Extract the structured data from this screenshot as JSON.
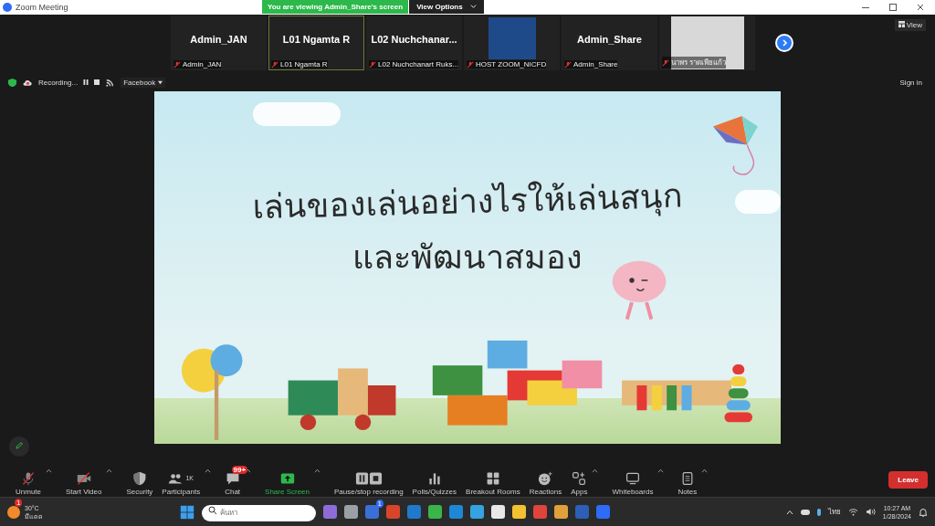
{
  "window": {
    "title": "Zoom Meeting"
  },
  "share_banner": {
    "text": "You are viewing Admin_Share's screen",
    "button": "View Options"
  },
  "participants": [
    {
      "kind": "name",
      "display": "Admin_JAN",
      "label": "Admin_JAN",
      "selected": false
    },
    {
      "kind": "name",
      "display": "L01 Ngamta R",
      "label": "L01 Ngamta R",
      "selected": true
    },
    {
      "kind": "name",
      "display": "L02  Nuchchanar...",
      "label": "L02 Nuchchanart Ruks...",
      "selected": false
    },
    {
      "kind": "logo",
      "label": "HOST ZOOM_NICFD",
      "selected": false
    },
    {
      "kind": "name",
      "display": "Admin_Share",
      "label": "Admin_Share",
      "selected": false
    },
    {
      "kind": "video",
      "label": "นาพร ราดเพียแก้ว",
      "selected": false
    }
  ],
  "view_button": "View",
  "recording": {
    "label": "Recording...",
    "stream": "Facebook"
  },
  "sign_in": "Sign in",
  "slide": {
    "title_line1": "เล่นของเล่นอย่างไรให้เล่นสนุก",
    "title_line2": "และพัฒนาสมอง"
  },
  "toolbar": [
    {
      "kind": "mic",
      "label": "Unmute",
      "caret": true,
      "highlighted": false
    },
    {
      "kind": "video",
      "label": "Start Video",
      "caret": true,
      "highlighted": false
    },
    {
      "kind": "shield",
      "label": "Security",
      "caret": false,
      "highlighted": false
    },
    {
      "kind": "people",
      "label": "Participants",
      "count": "1K",
      "caret": true,
      "highlighted": false
    },
    {
      "kind": "chat",
      "label": "Chat",
      "badge": "99+",
      "caret": true,
      "highlighted": false
    },
    {
      "kind": "share",
      "label": "Share Screen",
      "caret": true,
      "highlighted": true
    },
    {
      "kind": "record",
      "label": "Pause/stop recording",
      "caret": false,
      "highlighted": false
    },
    {
      "kind": "bars",
      "label": "Polls/Quizzes",
      "caret": false,
      "highlighted": false
    },
    {
      "kind": "grid",
      "label": "Breakout Rooms",
      "caret": false,
      "highlighted": false
    },
    {
      "kind": "smile",
      "label": "Reactions",
      "caret": false,
      "highlighted": false
    },
    {
      "kind": "apps",
      "label": "Apps",
      "caret": true,
      "highlighted": false
    },
    {
      "kind": "board",
      "label": "Whiteboards",
      "caret": true,
      "highlighted": false
    },
    {
      "kind": "notes",
      "label": "Notes",
      "caret": true,
      "highlighted": false
    }
  ],
  "leave_button": "Leave",
  "taskbar": {
    "weather_badge": "1",
    "temperature": "30°C",
    "weather": "มีแดด",
    "search_placeholder": "ค้นหา",
    "apps": [
      {
        "color": "#8e6cd8"
      },
      {
        "color": "#9aa0a6"
      },
      {
        "color": "#3b6fd8",
        "badge": "1"
      },
      {
        "color": "#d9452b"
      },
      {
        "color": "#1f7acc"
      },
      {
        "color": "#3bb54a"
      },
      {
        "color": "#1e88d6"
      },
      {
        "color": "#36a3e0"
      },
      {
        "color": "#e8e8e8"
      },
      {
        "color": "#f2c230"
      },
      {
        "color": "#e0443b"
      },
      {
        "color": "#e0a03b"
      },
      {
        "color": "#2b5fb8"
      },
      {
        "color": "#2d6cf6"
      }
    ],
    "language": "ไทย",
    "time": "10:27 AM",
    "date": "1/28/2024"
  }
}
